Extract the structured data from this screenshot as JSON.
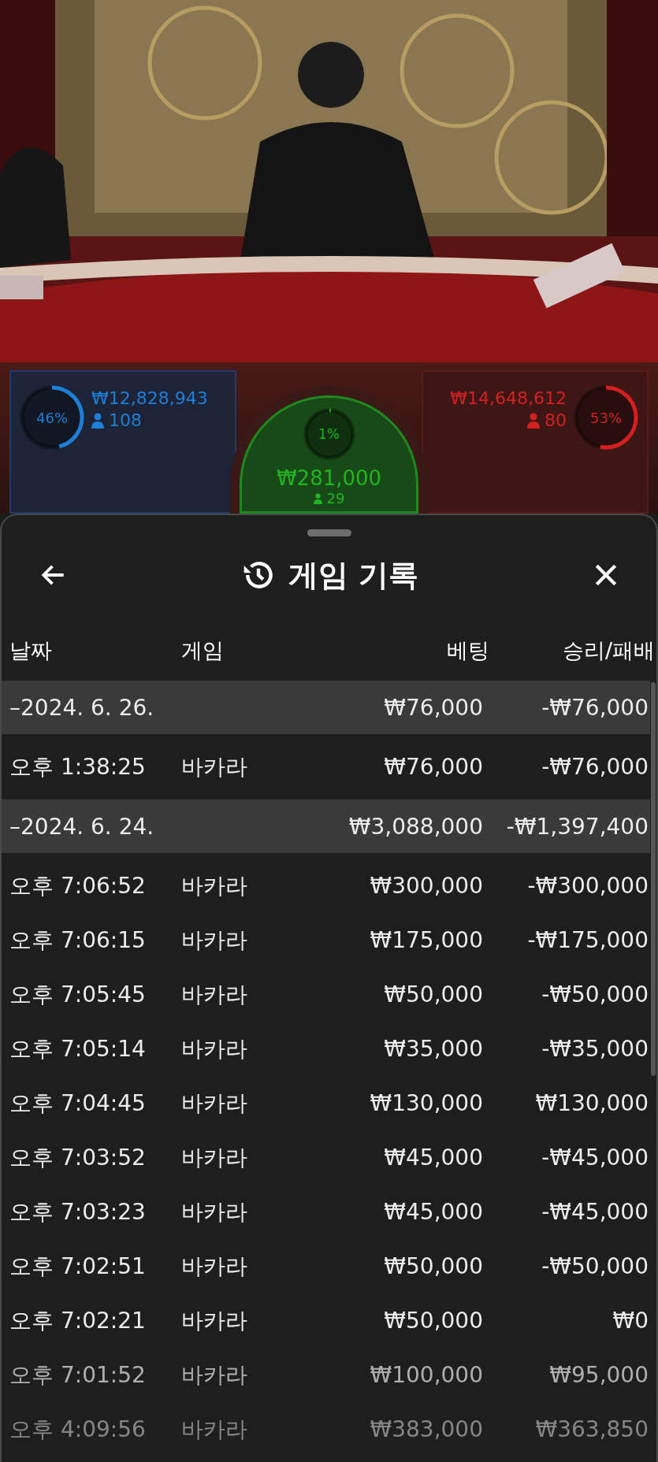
{
  "bet_stats": [
    {
      "kind": "player",
      "percent": "46%",
      "level": 0.46,
      "amount": "₩12,828,943",
      "players": "108"
    },
    {
      "kind": "tie",
      "percent": "1%",
      "level": 0.01,
      "amount": "₩281,000",
      "players": "29"
    },
    {
      "kind": "banker",
      "percent": "53%",
      "level": 0.53,
      "amount": "₩14,648,612",
      "players": "80"
    }
  ],
  "sheet": {
    "title": "게임 기록",
    "columns": [
      "날짜",
      "게임",
      "베팅",
      "승리/패배"
    ],
    "rows": [
      {
        "kind": "date",
        "date": "–2024. 6. 26.",
        "bet": "₩76,000",
        "result": "-₩76,000"
      },
      {
        "kind": "entry",
        "time": "오후 1:38:25",
        "game": "바카라",
        "bet": "₩76,000",
        "result": "-₩76,000"
      },
      {
        "kind": "date",
        "date": "–2024. 6. 24.",
        "bet": "₩3,088,000",
        "result": "-₩1,397,400"
      },
      {
        "kind": "entry",
        "time": "오후 7:06:52",
        "game": "바카라",
        "bet": "₩300,000",
        "result": "-₩300,000"
      },
      {
        "kind": "entry",
        "time": "오후 7:06:15",
        "game": "바카라",
        "bet": "₩175,000",
        "result": "-₩175,000"
      },
      {
        "kind": "entry",
        "time": "오후 7:05:45",
        "game": "바카라",
        "bet": "₩50,000",
        "result": "-₩50,000"
      },
      {
        "kind": "entry",
        "time": "오후 7:05:14",
        "game": "바카라",
        "bet": "₩35,000",
        "result": "-₩35,000"
      },
      {
        "kind": "entry",
        "time": "오후 7:04:45",
        "game": "바카라",
        "bet": "₩130,000",
        "result": "₩130,000"
      },
      {
        "kind": "entry",
        "time": "오후 7:03:52",
        "game": "바카라",
        "bet": "₩45,000",
        "result": "-₩45,000"
      },
      {
        "kind": "entry",
        "time": "오후 7:03:23",
        "game": "바카라",
        "bet": "₩45,000",
        "result": "-₩45,000"
      },
      {
        "kind": "entry",
        "time": "오후 7:02:51",
        "game": "바카라",
        "bet": "₩50,000",
        "result": "-₩50,000"
      },
      {
        "kind": "entry",
        "time": "오후 7:02:21",
        "game": "바카라",
        "bet": "₩50,000",
        "result": "₩0"
      },
      {
        "kind": "entry",
        "time": "오후 7:01:52",
        "game": "바카라",
        "bet": "₩100,000",
        "result": "₩95,000"
      },
      {
        "kind": "entry",
        "time": "오후 4:09:56",
        "game": "바카라",
        "bet": "₩383,000",
        "result": "₩363,850"
      }
    ]
  }
}
